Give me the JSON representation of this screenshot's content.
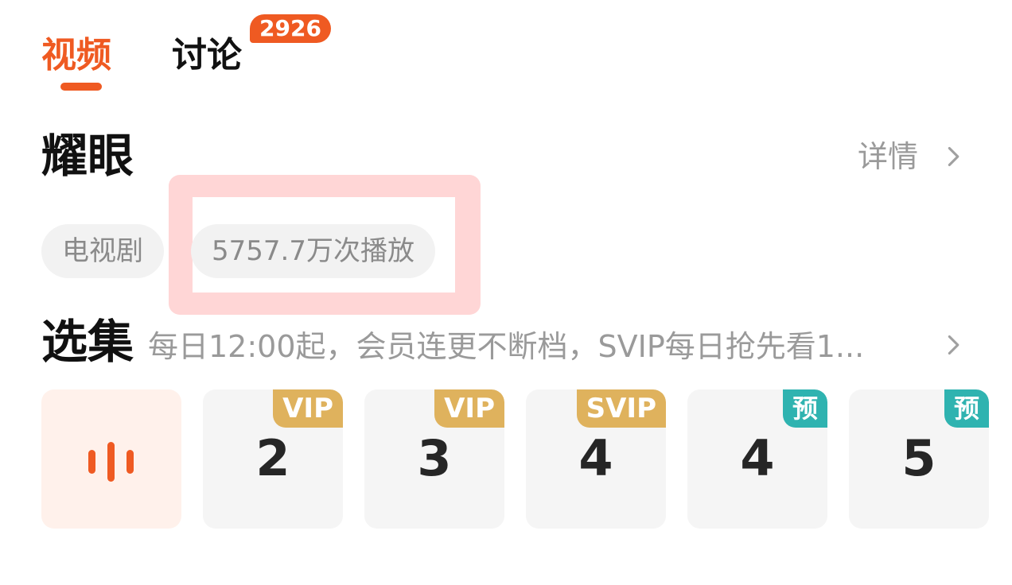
{
  "tabs": {
    "video": "视频",
    "discuss": "讨论",
    "discuss_badge": "2926"
  },
  "show": {
    "title": "耀眼",
    "details_label": "详情",
    "tags": [
      "电视剧",
      "5757.7万次播放"
    ]
  },
  "episodes_section": {
    "title": "选集",
    "description": "每日12:00起，会员连更不断档，SVIP每日抢先看1..."
  },
  "episodes": [
    {
      "number": "",
      "badge": "",
      "state": "playing"
    },
    {
      "number": "2",
      "badge": "VIP"
    },
    {
      "number": "3",
      "badge": "VIP"
    },
    {
      "number": "4",
      "badge": "SVIP"
    },
    {
      "number": "4",
      "badge": "预"
    },
    {
      "number": "5",
      "badge": "预"
    }
  ],
  "colors": {
    "accent": "#ef5a22",
    "vip_badge": "#dfb25d",
    "preview_badge": "#2fb3b0",
    "highlight": "#ffd6d6"
  },
  "icons": {
    "chevron": "chevron-right-icon",
    "playing": "audio-bars-icon"
  }
}
